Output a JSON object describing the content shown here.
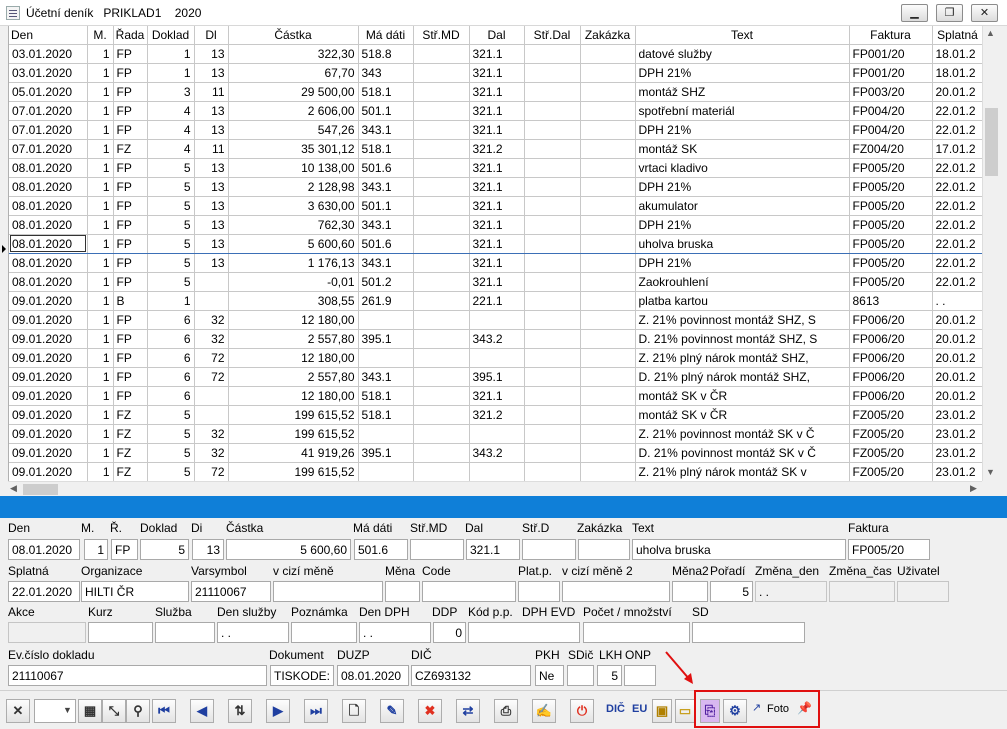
{
  "window": {
    "title": "Účetní deník   PRIKLAD1    2020",
    "buttons": [
      "minimize",
      "restore",
      "close"
    ]
  },
  "grid": {
    "columns": [
      "Den",
      "M.",
      "Řada",
      "Doklad",
      "Dl",
      "Částka",
      "Má dáti",
      "Stř.MD",
      "Dal",
      "Stř.Dal",
      "Zakázka",
      "Text",
      "Faktura",
      "Splatná"
    ],
    "selected_row": 10,
    "rows": [
      [
        "03.01.2020",
        "1",
        "FP",
        "1",
        "13",
        "322,30",
        "518.8",
        "",
        "321.1",
        "",
        "",
        "datové služby",
        "FP001/20",
        "18.01.2"
      ],
      [
        "03.01.2020",
        "1",
        "FP",
        "1",
        "13",
        "67,70",
        "343",
        "",
        "321.1",
        "",
        "",
        "DPH 21%",
        "FP001/20",
        "18.01.2"
      ],
      [
        "05.01.2020",
        "1",
        "FP",
        "3",
        "11",
        "29 500,00",
        "518.1",
        "",
        "321.1",
        "",
        "",
        "montáž SHZ",
        "FP003/20",
        "20.01.2"
      ],
      [
        "07.01.2020",
        "1",
        "FP",
        "4",
        "13",
        "2 606,00",
        "501.1",
        "",
        "321.1",
        "",
        "",
        "spotřební materiál",
        "FP004/20",
        "22.01.2"
      ],
      [
        "07.01.2020",
        "1",
        "FP",
        "4",
        "13",
        "547,26",
        "343.1",
        "",
        "321.1",
        "",
        "",
        "DPH 21%",
        "FP004/20",
        "22.01.2"
      ],
      [
        "07.01.2020",
        "1",
        "FZ",
        "4",
        "11",
        "35 301,12",
        "518.1",
        "",
        "321.2",
        "",
        "",
        "montáž SK",
        "FZ004/20",
        "17.01.2"
      ],
      [
        "08.01.2020",
        "1",
        "FP",
        "5",
        "13",
        "10 138,00",
        "501.6",
        "",
        "321.1",
        "",
        "",
        "vrtaci kladivo",
        "FP005/20",
        "22.01.2"
      ],
      [
        "08.01.2020",
        "1",
        "FP",
        "5",
        "13",
        "2 128,98",
        "343.1",
        "",
        "321.1",
        "",
        "",
        "DPH 21%",
        "FP005/20",
        "22.01.2"
      ],
      [
        "08.01.2020",
        "1",
        "FP",
        "5",
        "13",
        "3 630,00",
        "501.1",
        "",
        "321.1",
        "",
        "",
        "akumulator",
        "FP005/20",
        "22.01.2"
      ],
      [
        "08.01.2020",
        "1",
        "FP",
        "5",
        "13",
        "762,30",
        "343.1",
        "",
        "321.1",
        "",
        "",
        "DPH 21%",
        "FP005/20",
        "22.01.2"
      ],
      [
        "08.01.2020",
        "1",
        "FP",
        "5",
        "13",
        "5 600,60",
        "501.6",
        "",
        "321.1",
        "",
        "",
        "uholva bruska",
        "FP005/20",
        "22.01.2"
      ],
      [
        "08.01.2020",
        "1",
        "FP",
        "5",
        "13",
        "1 176,13",
        "343.1",
        "",
        "321.1",
        "",
        "",
        "DPH 21%",
        "FP005/20",
        "22.01.2"
      ],
      [
        "08.01.2020",
        "1",
        "FP",
        "5",
        "",
        "-0,01",
        "501.2",
        "",
        "321.1",
        "",
        "",
        "Zaokrouhlení",
        "FP005/20",
        "22.01.2"
      ],
      [
        "09.01.2020",
        "1",
        "B",
        "1",
        "",
        "308,55",
        "261.9",
        "",
        "221.1",
        "",
        "",
        "platba kartou",
        "8613",
        " .  ."
      ],
      [
        "09.01.2020",
        "1",
        "FP",
        "6",
        "32",
        "12 180,00",
        "",
        "",
        "",
        "",
        "",
        "Z. 21% povinnost montáž SHZ, S",
        "FP006/20",
        "20.01.2"
      ],
      [
        "09.01.2020",
        "1",
        "FP",
        "6",
        "32",
        "2 557,80",
        "395.1",
        "",
        "343.2",
        "",
        "",
        "D. 21% povinnost montáž SHZ, S",
        "FP006/20",
        "20.01.2"
      ],
      [
        "09.01.2020",
        "1",
        "FP",
        "6",
        "72",
        "12 180,00",
        "",
        "",
        "",
        "",
        "",
        "Z. 21% plný nárok montáž SHZ,",
        "FP006/20",
        "20.01.2"
      ],
      [
        "09.01.2020",
        "1",
        "FP",
        "6",
        "72",
        "2 557,80",
        "343.1",
        "",
        "395.1",
        "",
        "",
        "D. 21% plný nárok montáž SHZ,",
        "FP006/20",
        "20.01.2"
      ],
      [
        "09.01.2020",
        "1",
        "FP",
        "6",
        "",
        "12 180,00",
        "518.1",
        "",
        "321.1",
        "",
        "",
        "montáž SK v ČR",
        "FP006/20",
        "20.01.2"
      ],
      [
        "09.01.2020",
        "1",
        "FZ",
        "5",
        "",
        "199 615,52",
        "518.1",
        "",
        "321.2",
        "",
        "",
        "montáž SK v ČR",
        "FZ005/20",
        "23.01.2"
      ],
      [
        "09.01.2020",
        "1",
        "FZ",
        "5",
        "32",
        "199 615,52",
        "",
        "",
        "",
        "",
        "",
        "Z. 21% povinnost montáž SK v Č",
        "FZ005/20",
        "23.01.2"
      ],
      [
        "09.01.2020",
        "1",
        "FZ",
        "5",
        "32",
        "41 919,26",
        "395.1",
        "",
        "343.2",
        "",
        "",
        "D. 21% povinnost montáž SK v Č",
        "FZ005/20",
        "23.01.2"
      ],
      [
        "09.01.2020",
        "1",
        "FZ",
        "5",
        "72",
        "199 615,52",
        "",
        "",
        "",
        "",
        "",
        "Z. 21% plný nárok montáž SK v",
        "FZ005/20",
        "23.01.2"
      ]
    ]
  },
  "detail": {
    "labels": {
      "den": "Den",
      "m": "M.",
      "r": "Ř.",
      "doklad": "Doklad",
      "di": "Di",
      "castka": "Částka",
      "madati": "Má dáti",
      "strmd": "Stř.MD",
      "dal": "Dal",
      "strd": "Stř.D",
      "zakazka": "Zakázka",
      "text": "Text",
      "faktura": "Faktura",
      "splatna": "Splatná",
      "organizace": "Organizace",
      "varsymbol": "Varsymbol",
      "vcizimene": "v cizí měně",
      "mena": "Měna",
      "code": "Code",
      "platp": "Plat.p.",
      "vcizimene2": "v cizí měně 2",
      "mena2": "Měna2",
      "poradi": "Pořadí",
      "zmenaden": "Změna_den",
      "zmenacas": "Změna_čas",
      "uzivatel": "Uživatel",
      "akce": "Akce",
      "kurz": "Kurz",
      "sluzba": "Služba",
      "densluzby": "Den služby",
      "poznamka": "Poznámka",
      "dendph": "Den DPH",
      "ddp": "DDP",
      "kodpp": "Kód p.p.",
      "dphevd": "DPH EVD",
      "pocet": "Počet / množství",
      "sd": "SD",
      "evcislo": "Ev.číslo dokladu",
      "dokument": "Dokument",
      "duzp": "DUZP",
      "dic": "DIČ",
      "pkh": "PKH",
      "sdic": "SDič",
      "lkh": "LKH",
      "onp": "ONP"
    },
    "values": {
      "den": "08.01.2020",
      "m": "1",
      "r": "FP",
      "doklad": "5",
      "di": "13",
      "castka": "5 600,60",
      "madati": "501.6",
      "strmd": "",
      "dal": "321.1",
      "strd": "",
      "zakazka": "",
      "text": "uholva bruska",
      "faktura": "FP005/20",
      "splatna": "22.01.2020",
      "organizace": "HILTI ČR",
      "varsymbol": "21110067",
      "vcizimene": "",
      "mena": "",
      "code": "",
      "platp": "",
      "vcizimene2": "",
      "mena2": "",
      "poradi": "5",
      "zmenaden": " .  .",
      "zmenacas": "",
      "uzivatel": "",
      "akce": "",
      "kurz": "",
      "sluzba": "",
      "densluzby": " .  .",
      "poznamka": "",
      "dendph": " .  .",
      "ddp": "0",
      "kodpp": "",
      "dphevd": "",
      "pocet": "",
      "sd": "",
      "evcislo": "21110067",
      "dokument": "TISKODE:",
      "duzp": "08.01.2020",
      "dic": "CZ693132",
      "pkh": "Ne",
      "sdic": "",
      "lkh": "5",
      "onp": ""
    }
  },
  "toolbar": {
    "buttons": [
      {
        "name": "cancel-button",
        "glyph": "✕"
      },
      {
        "name": "table-view-button",
        "glyph": "▦"
      },
      {
        "name": "resize-button",
        "glyph": "⤡"
      },
      {
        "name": "find-button",
        "glyph": "🔍"
      },
      {
        "name": "first-record-button",
        "glyph": "⏮"
      },
      {
        "name": "prev-record-button",
        "glyph": "◀"
      },
      {
        "name": "sort-button",
        "glyph": "⇅"
      },
      {
        "name": "next-record-button",
        "glyph": "▶"
      },
      {
        "name": "last-record-button",
        "glyph": "⏭"
      },
      {
        "name": "new-document-button",
        "glyph": "🗋"
      },
      {
        "name": "edit-button",
        "glyph": "✎"
      },
      {
        "name": "delete-button",
        "glyph": "✖"
      },
      {
        "name": "transfer-button",
        "glyph": "⇄"
      },
      {
        "name": "print-button",
        "glyph": "⎙"
      },
      {
        "name": "stamp-button",
        "glyph": "✍"
      },
      {
        "name": "power-button",
        "glyph": "⏻"
      }
    ],
    "dic_label": "DIČ",
    "eu_label": "EU",
    "foto_label": "Foto",
    "attachment_icon": "paperclip-icon",
    "pin_icon": "pin-icon"
  }
}
